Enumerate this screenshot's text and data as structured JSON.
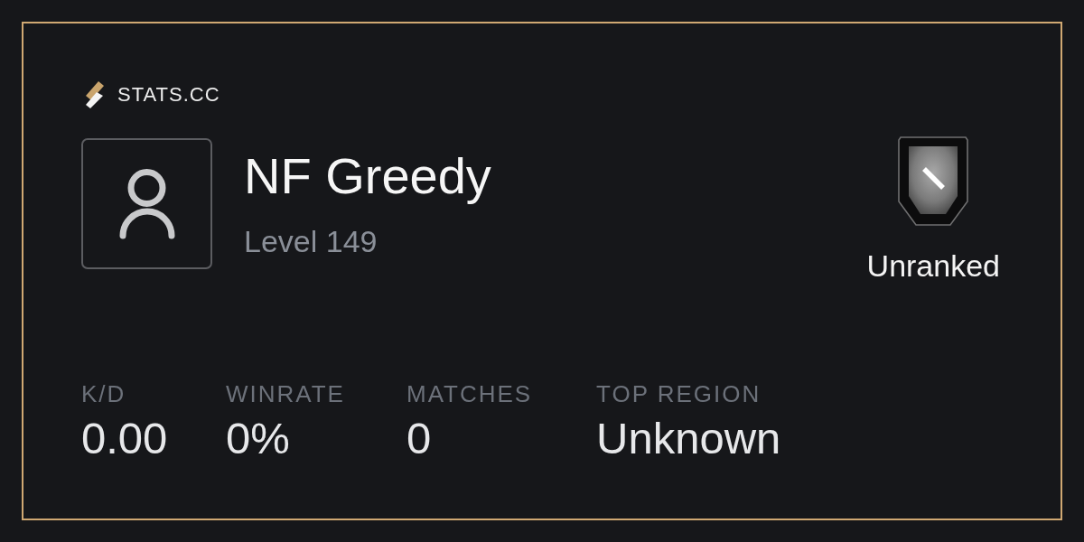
{
  "brand": {
    "name": "STATS.CC"
  },
  "profile": {
    "name": "NF Greedy",
    "level": "Level 149"
  },
  "rank": {
    "label": "Unranked"
  },
  "stats": [
    {
      "label": "K/D",
      "value": "0.00"
    },
    {
      "label": "WINRATE",
      "value": "0%"
    },
    {
      "label": "MATCHES",
      "value": "0"
    },
    {
      "label": "TOP REGION",
      "value": "Unknown"
    }
  ]
}
